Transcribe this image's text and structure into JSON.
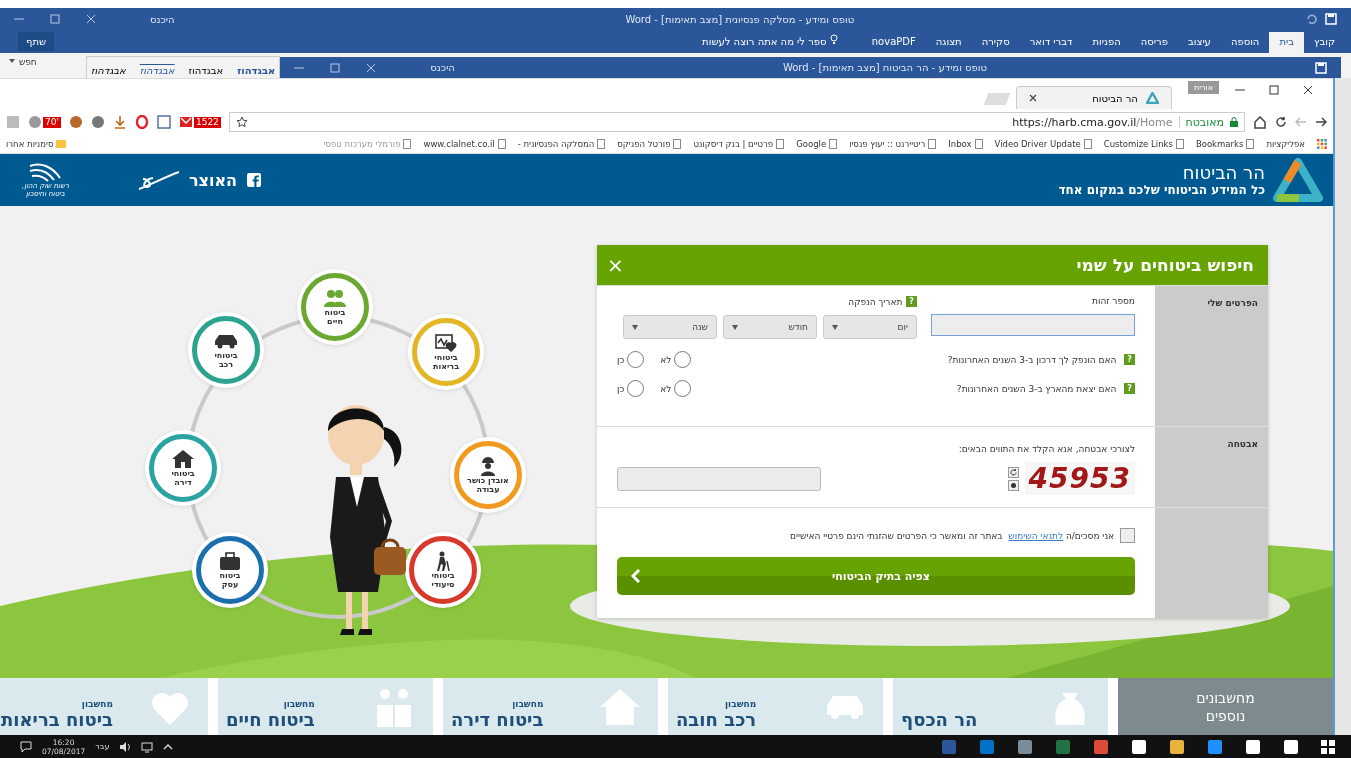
{
  "word_back": {
    "title": "טופס ומידע - מסלקה פנסיונית [מצב תאימות] - Word",
    "sign_in": "היכנס",
    "share": "שתף",
    "tabs": [
      {
        "label": "קובץ",
        "selected": false
      },
      {
        "label": "בית",
        "selected": true
      },
      {
        "label": "הוספה",
        "selected": false
      },
      {
        "label": "עיצוב",
        "selected": false
      },
      {
        "label": "פריסה",
        "selected": false
      },
      {
        "label": "הפניות",
        "selected": false
      },
      {
        "label": "דברי דואר",
        "selected": false
      },
      {
        "label": "סקירה",
        "selected": false
      },
      {
        "label": "תצוגה",
        "selected": false
      },
      {
        "label": "novaPDF",
        "selected": false
      }
    ],
    "tell_me": "ספר לי מה אתה רוצה לעשות",
    "find": "חפש",
    "styles": [
      {
        "label": "אבגדהוז",
        "kind": "bold"
      },
      {
        "label": "אבגדהוז",
        "kind": "normal"
      },
      {
        "label": "אבגדהוז",
        "kind": "emphasis"
      },
      {
        "label": "אבגדהוז",
        "kind": "italic"
      }
    ]
  },
  "word_front": {
    "title": "טופס ומידע - הר הביטוח [מצב תאימות] - Word",
    "sign_in": "היכנס"
  },
  "browser": {
    "profile": "אורית",
    "tab": "הר הביטוח",
    "security": "מאובטח",
    "url_host": "https://harb.cma.gov.il",
    "url_path": "/Home",
    "extension_badges": [
      "1522",
      "70'"
    ],
    "bookmarks": [
      "אפליקציות",
      "Bookmarks",
      "Customize Links",
      "Video Driver Update",
      "Inbox",
      "ריטיירנט :: יעוץ פנסיו",
      "Google",
      "פרטיים | בנק דיסקונט",
      "פורטל הפניקס",
      "המסלקה הפנסיונית -",
      "www.clalnet.co.il",
      "פורמלי מערכות טפסי"
    ],
    "other_bookmarks": "סימניות אחרו"
  },
  "site": {
    "title": "הר הביטוח",
    "tagline": "כל המידע הביטוחי שלכם במקום אחד",
    "treasury": "האוצר",
    "authority": [
      "רשות שוק ההון,",
      "ביטוח וחיסכון"
    ]
  },
  "dialog": {
    "title": "חיפוש ביטוחים על שמי",
    "close": "×",
    "sections": [
      "הפרטים שלי",
      "אבטחה"
    ],
    "id_label": "מספר זהות",
    "date_label": "תאריך הנפקה",
    "help": "?",
    "selects": [
      "יום",
      "חודש",
      "שנה"
    ],
    "questions": [
      {
        "text": "האם הונפק לך דרכון ב-3 השנים האחרונות?",
        "options": [
          {
            "label": "לא",
            "selected": false
          },
          {
            "label": "כן",
            "selected": false
          }
        ]
      },
      {
        "text": "האם יצאת מהארץ ב-3 השנים האחרונות?",
        "options": [
          {
            "label": "לא",
            "selected": false
          },
          {
            "label": "כן",
            "selected": false
          }
        ]
      }
    ],
    "captcha_prompt": "לצורכי אבטחה, אנא הקלד את התווים הבאים:",
    "captcha": "45953",
    "agree": {
      "checked": false,
      "before": "אני מסכים/ה",
      "link": "לתנאי השימוש",
      "after": "באתר זה ומאשר כי הפרטים שהזנתי הינם פרטיי האישיים"
    },
    "submit": "צפיה בתיק הביטוחי"
  },
  "circles": [
    {
      "kind": "people",
      "lines": [
        "ביטוח",
        "חיים"
      ],
      "color": "#6aa832"
    },
    {
      "kind": "heart",
      "lines": [
        "ביטוחי",
        "בריאות"
      ],
      "color": "#e3b626"
    },
    {
      "kind": "worker",
      "lines": [
        "אובדן כושר",
        "עבודה"
      ],
      "color": "#f29a1f"
    },
    {
      "kind": "elder",
      "lines": [
        "ביטוחי",
        "סיעודי"
      ],
      "color": "#d8392b"
    },
    {
      "kind": "briefcase",
      "lines": [
        "ביטוח",
        "עסק"
      ],
      "color": "#1c6fae"
    },
    {
      "kind": "house",
      "lines": [
        "ביטוחי",
        "דירה"
      ],
      "color": "#2ba3a0"
    },
    {
      "kind": "car",
      "lines": [
        "ביטוחי",
        "רכב"
      ],
      "color": "#2ba38e"
    }
  ],
  "tiles": [
    {
      "kind": "more",
      "lines": [
        "מחשבונים",
        "נוספים"
      ]
    },
    {
      "kind": "money",
      "title": "הר הכסף"
    },
    {
      "kind": "car",
      "caption": "מחשבון",
      "title": "רכב חובה"
    },
    {
      "kind": "house",
      "caption": "מחשבון",
      "title": "ביטוח דירה"
    },
    {
      "kind": "family",
      "caption": "מחשבון",
      "title": "ביטוח חיים"
    },
    {
      "kind": "heart",
      "caption": "מחשבון",
      "title": "ביטוח בריאות"
    }
  ],
  "taskbar": {
    "time": "16:20",
    "date": "07/08/2017",
    "language": "עבר"
  }
}
